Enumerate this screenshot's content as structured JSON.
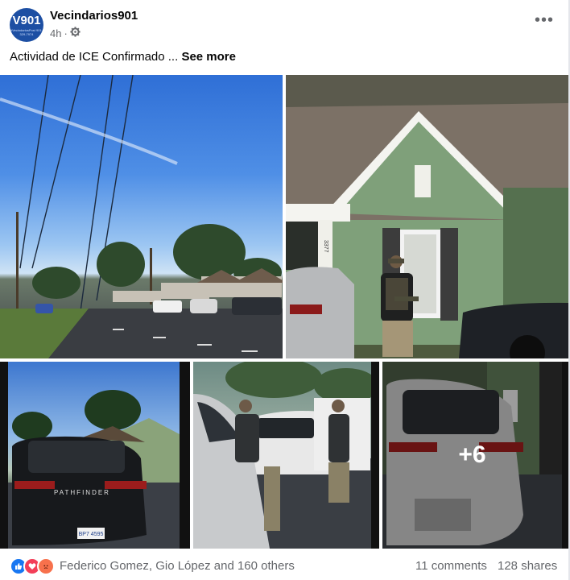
{
  "post": {
    "author": "Vecindarios901",
    "avatar_text": "V901",
    "avatar_small_text": "#VecindariosPost 901-329-7974",
    "time": "4h",
    "audience_icon": "gear-icon",
    "more_icon": "more-dots-icon",
    "more_label": "•••",
    "text": "Actividad de ICE Confirmado ...",
    "see_more": "See more"
  },
  "photos": {
    "house_number": "3377",
    "pathfinder_badge": "PATHFINDER",
    "plate": "BP7 4595",
    "extra_count": "+6"
  },
  "footer": {
    "reactions": [
      "like",
      "love",
      "angry"
    ],
    "reacted_by": "Federico Gomez, Gio López and 160 others",
    "comments": "11 comments",
    "shares": "128 shares"
  },
  "colors": {
    "like": "#1877f2",
    "love": "#f33e58",
    "angry": "#f7714c",
    "house_siding": "#7fa07a",
    "secondary_text": "#65676b"
  }
}
